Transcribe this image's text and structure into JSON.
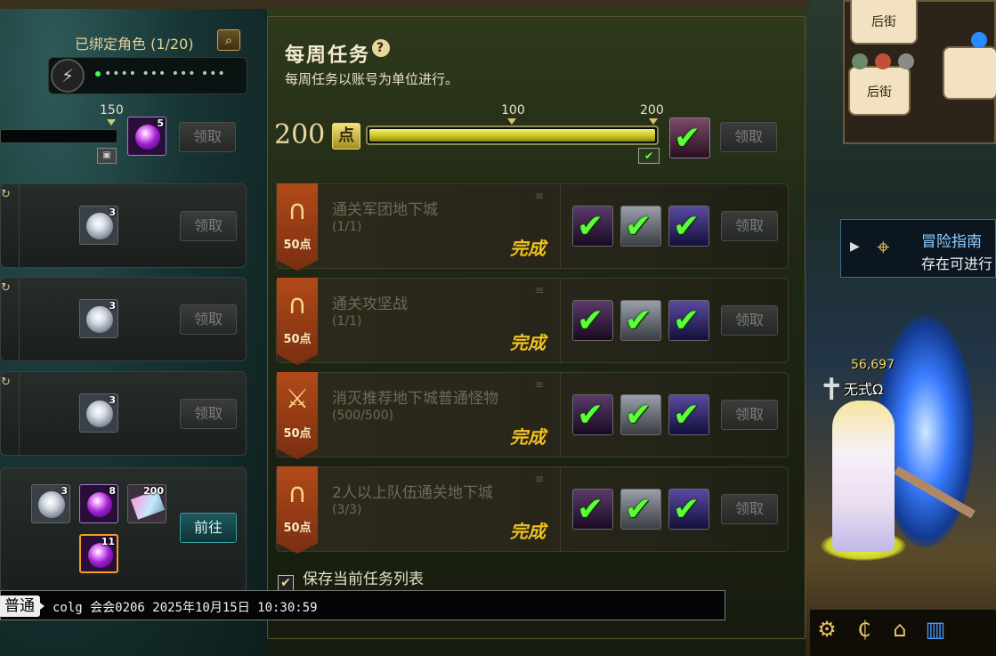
{
  "left_panel": {
    "bound_label": "已绑定角色 (1/20)",
    "search_icon": "magnifier-icon",
    "account_mask": "•••• ••• ••• •••",
    "progress_label": "150",
    "rows": [
      {
        "item_count": "5",
        "button": "领取"
      },
      {
        "item_count": "3",
        "button": "领取"
      },
      {
        "item_count": "3",
        "button": "领取"
      },
      {
        "item_count": "3",
        "button": "领取"
      }
    ],
    "last_row": {
      "items": [
        "3",
        "8",
        "200",
        "11"
      ],
      "button": "前往"
    }
  },
  "weekly": {
    "title": "每周任务",
    "help_icon": "?",
    "subtitle": "每周任务以账号为单位进行。",
    "points": "200",
    "points_badge": "点",
    "progress_fraction": 1.0,
    "milestone_100": "100",
    "milestone_200": "200",
    "claim_button": "领取",
    "tasks": [
      {
        "name": "通关军团地下城",
        "progress": "(1/1)",
        "points": "50点",
        "status": "完成",
        "button": "领取"
      },
      {
        "name": "通关攻坚战",
        "progress": "(1/1)",
        "points": "50点",
        "status": "完成",
        "button": "领取"
      },
      {
        "name": "消灭推荐地下城普通怪物",
        "progress": "(500/500)",
        "points": "50点",
        "status": "完成",
        "button": "领取"
      },
      {
        "name": "2人以上队伍通关地下城",
        "progress": "(3/3)",
        "points": "50点",
        "status": "完成",
        "button": "领取"
      }
    ],
    "save_label": "保存当前任务列表"
  },
  "chat": {
    "channel": "普通",
    "text": "colg 会会0206 2025年10月15日 10:30:59"
  },
  "game": {
    "map_labels": [
      "后街",
      "后街"
    ],
    "guide_title": "冒险指南",
    "guide_sub": "存在可进行",
    "char_number": "56,697",
    "char_name": "无式Ω"
  },
  "colors": {
    "accent_gold": "#f2c21e",
    "check_green": "#5aff3a",
    "bar_yellow": "#c8c020"
  }
}
